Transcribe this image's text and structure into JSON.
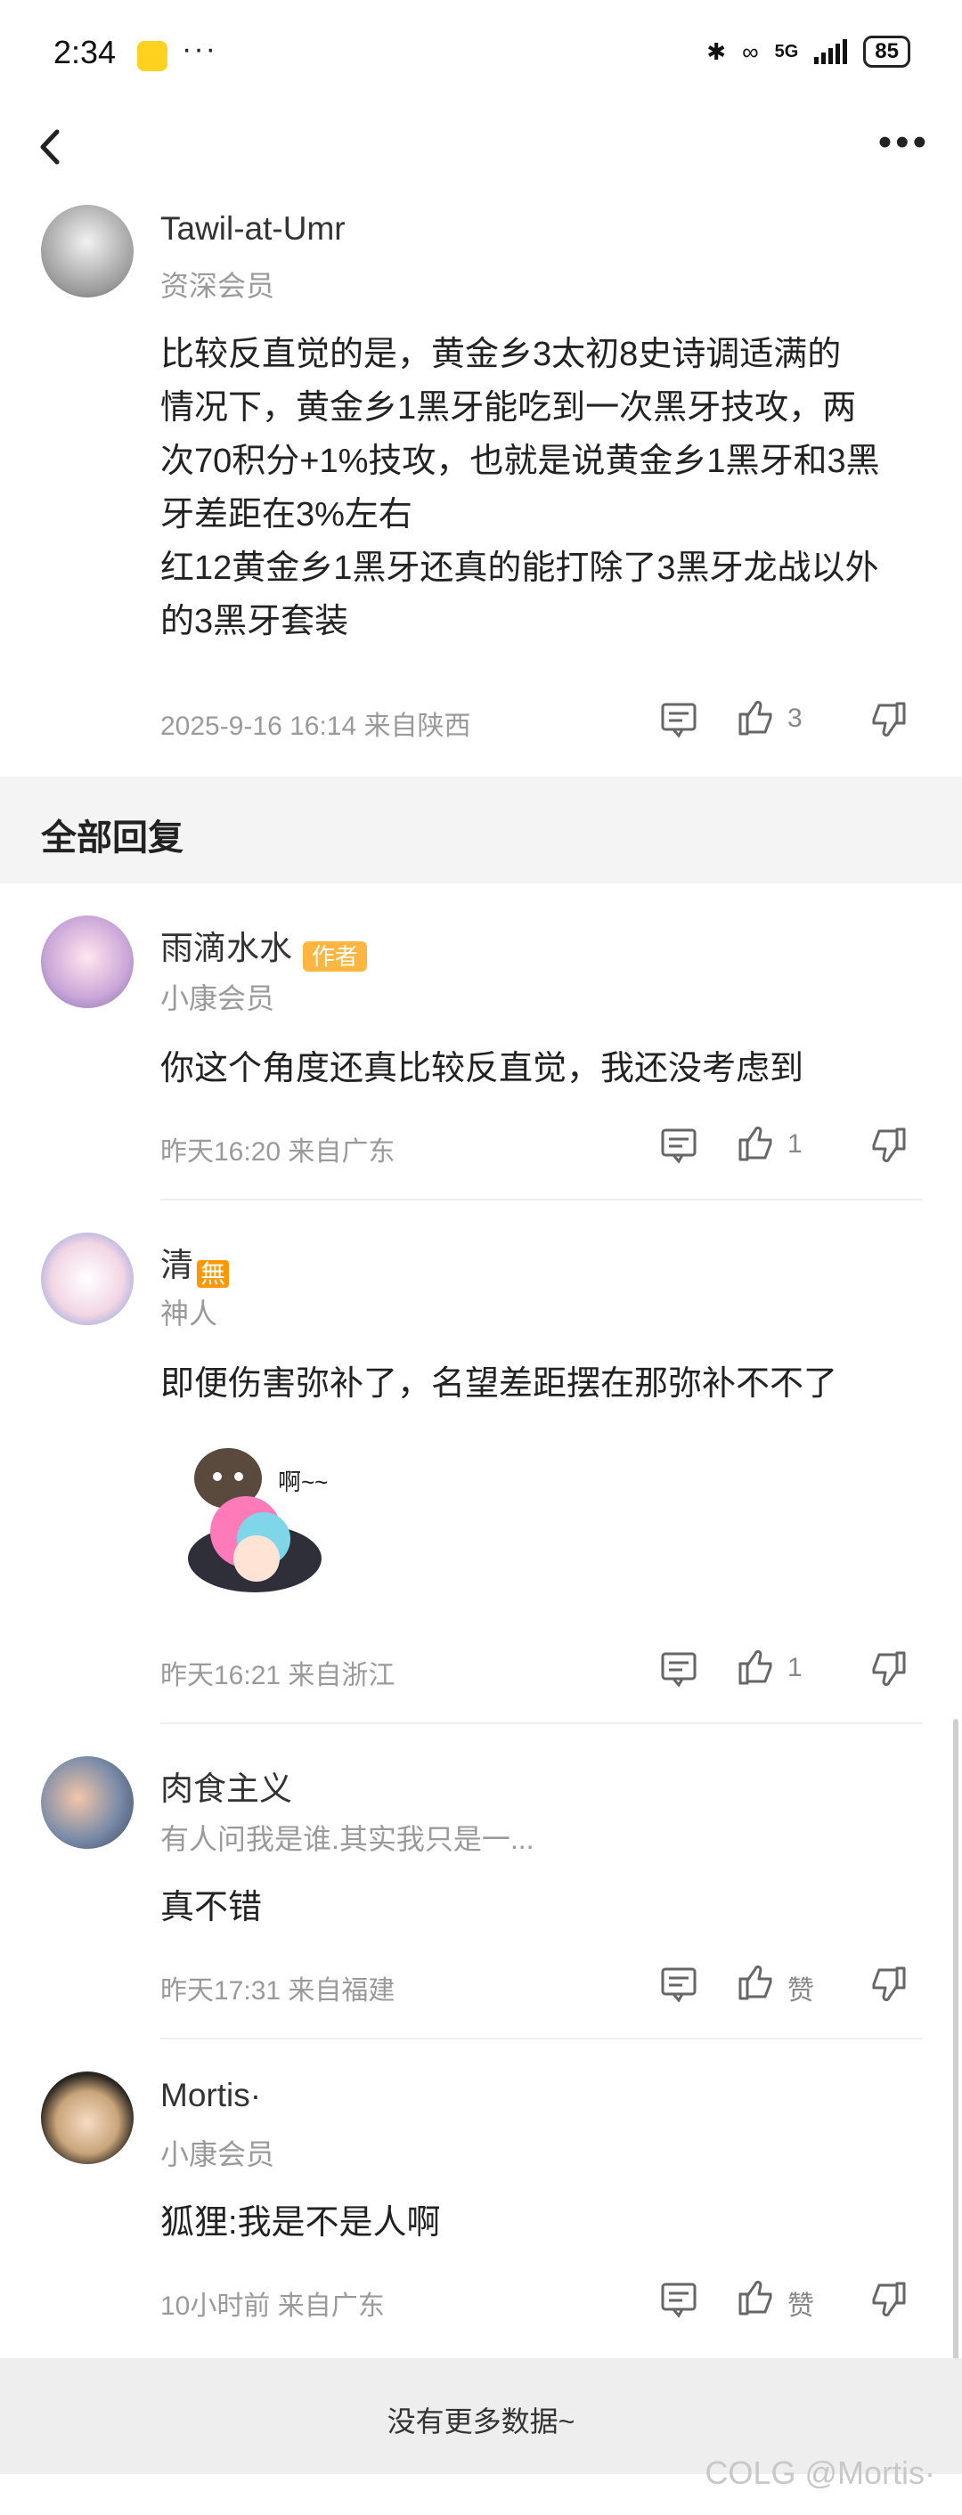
{
  "status": {
    "time": "2:34",
    "dots": "···",
    "network": "5G",
    "battery": "85"
  },
  "post": {
    "user": "Tawil-at-Umr",
    "level": "资深会员",
    "lines": [
      "比较反直觉的是，黄金乡3太初8史诗调适满的",
      "情况下，黄金乡1黑牙能吃到一次黑牙技攻，两",
      "次70积分+1%技攻，也就是说黄金乡1黑牙和3黑",
      "牙差距在3%左右",
      "红12黄金乡1黑牙还真的能打除了3黑牙龙战以外",
      "的3黑牙套装"
    ],
    "meta": "2025-9-16 16:14  来自陕西",
    "likes": "3"
  },
  "section_title": "全部回复",
  "replies": [
    {
      "user": "雨滴水水",
      "tag": "作者",
      "level": "小康会员",
      "content": "你这个角度还真比较反直觉，我还没考虑到",
      "meta": "昨天16:20 来自广东",
      "likes": "1"
    },
    {
      "user": "清",
      "tag": "無",
      "level": "神人",
      "content": "即便伤害弥补了，名望差距摆在那弥补不不了",
      "sticker_text": "啊~~",
      "meta": "昨天16:21 来自浙江",
      "likes": "1"
    },
    {
      "user": "肉食主义",
      "level": "有人问我是谁.其实我只是一...",
      "content": "真不错",
      "meta": "昨天17:31 来自福建",
      "likes": "赞"
    },
    {
      "user": "Mortis·",
      "level": "小康会员",
      "content": "狐狸:我是不是人啊",
      "meta": "10小时前 来自广东",
      "likes": "赞"
    }
  ],
  "footer": "没有更多数据~",
  "watermark": "COLG @Mortis·"
}
